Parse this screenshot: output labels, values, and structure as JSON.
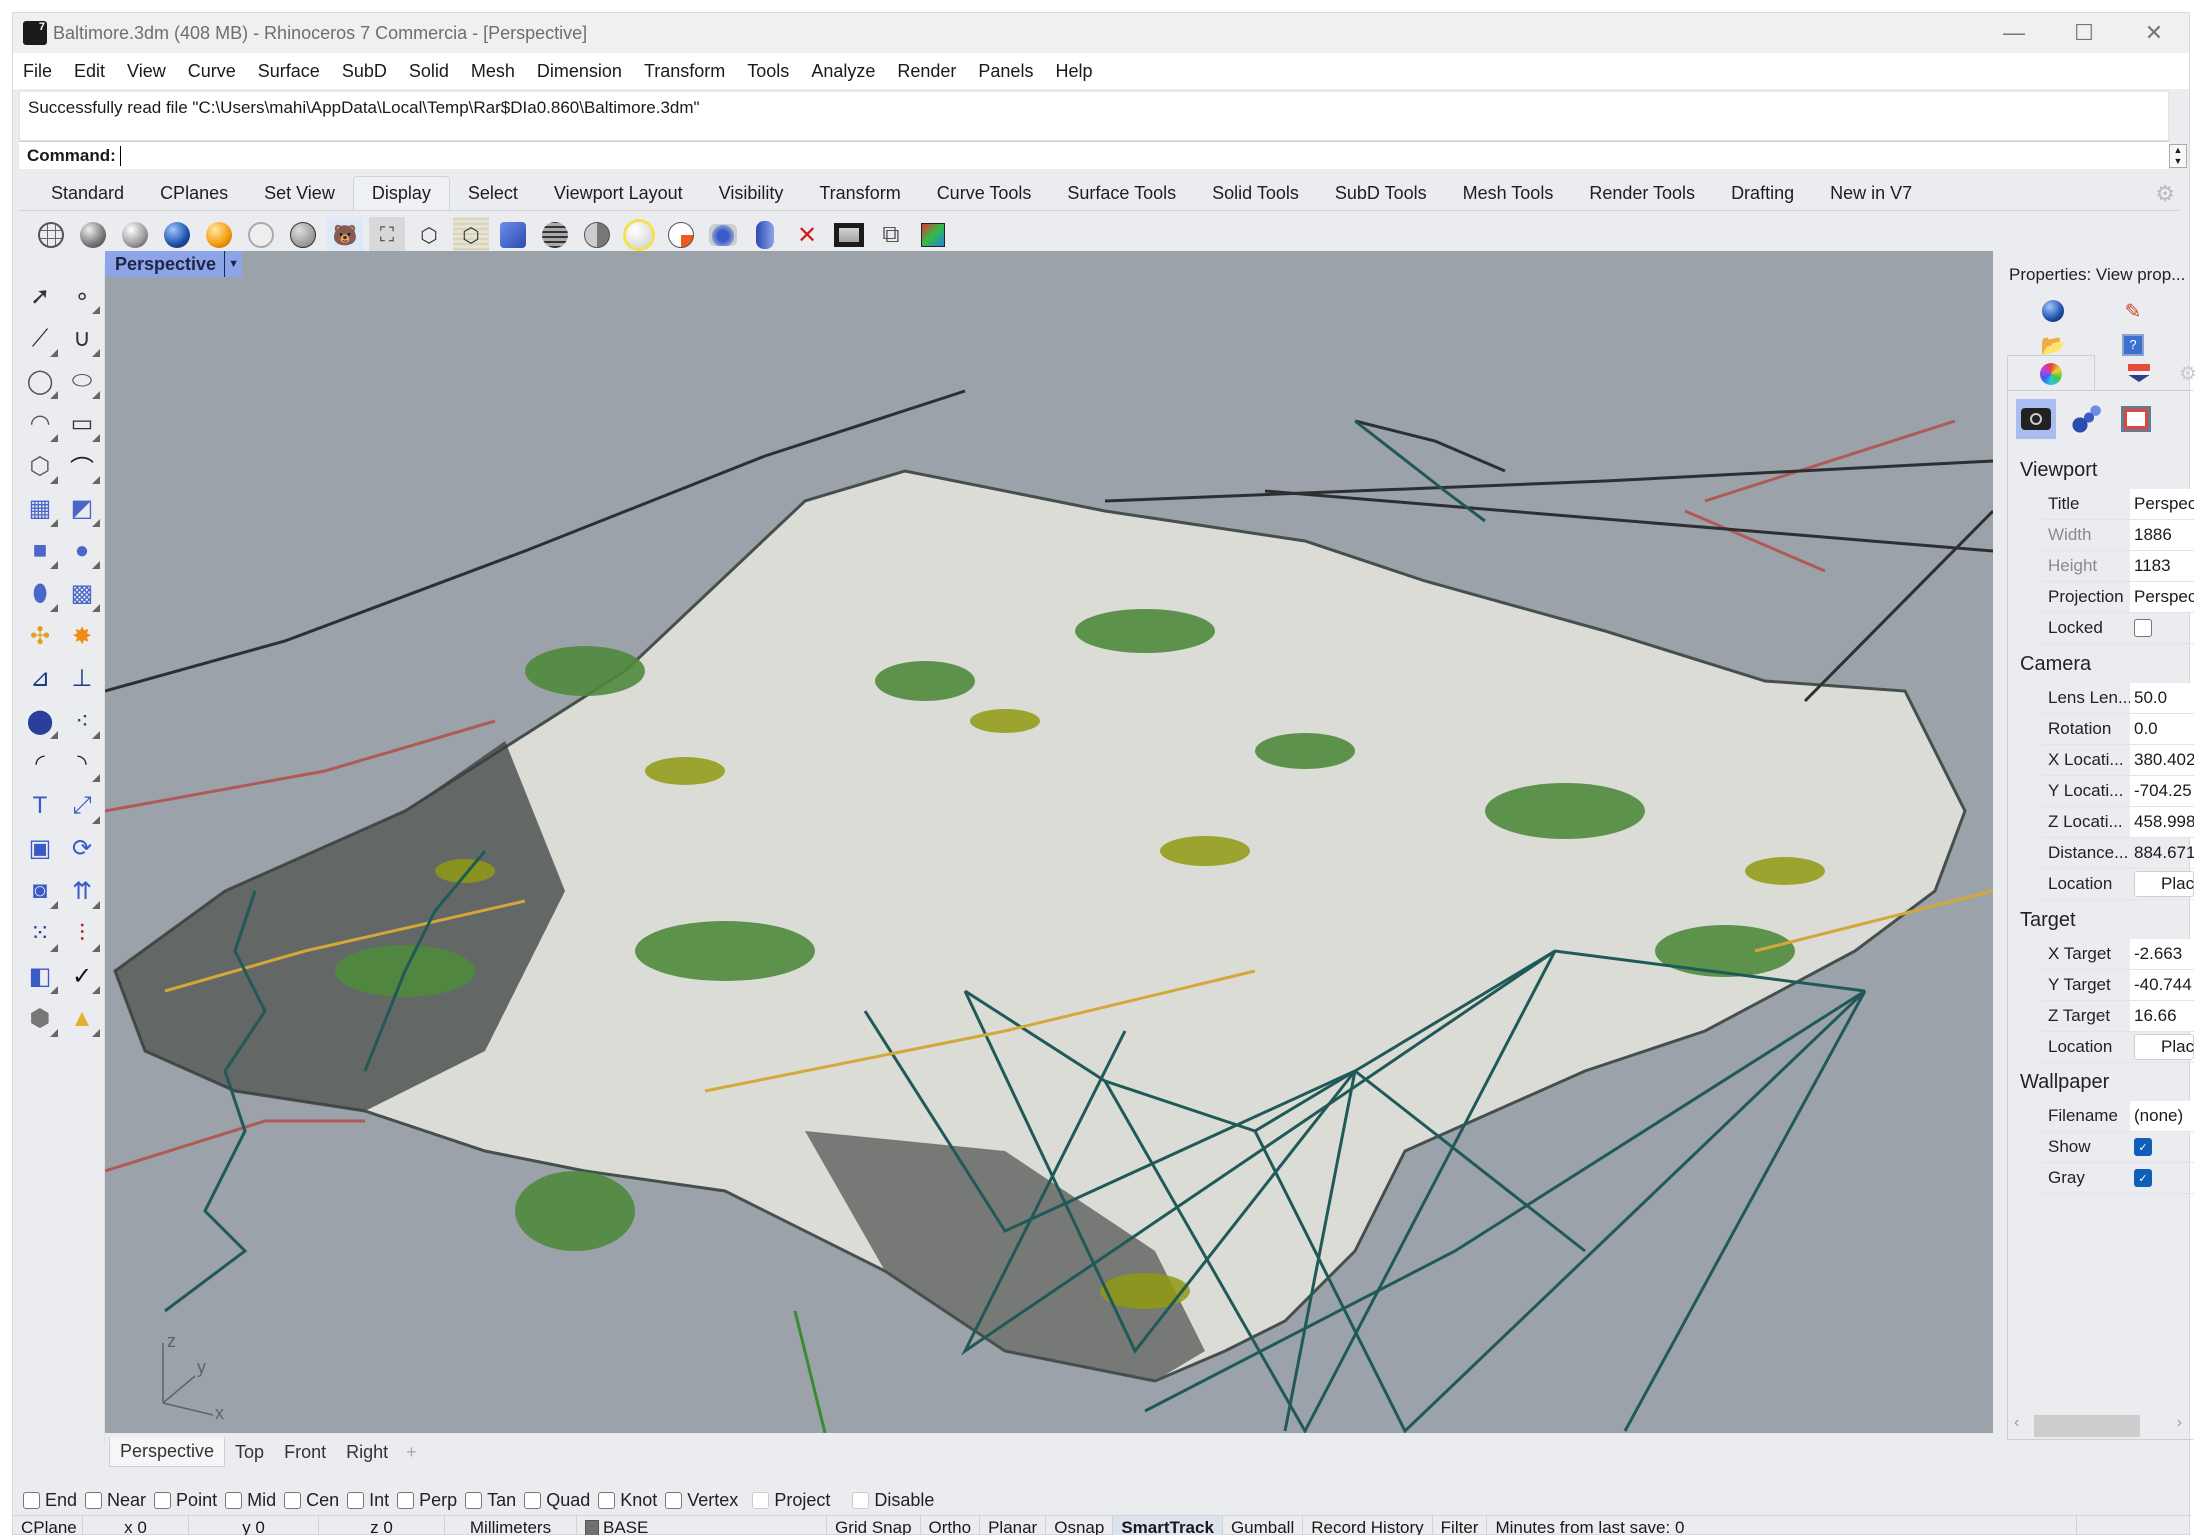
{
  "window": {
    "title": "Baltimore.3dm (408 MB) - Rhinoceros 7 Commercia - [Perspective]",
    "minimize": "—",
    "maximize": "☐",
    "close": "✕"
  },
  "menu": [
    "File",
    "Edit",
    "View",
    "Curve",
    "Surface",
    "SubD",
    "Solid",
    "Mesh",
    "Dimension",
    "Transform",
    "Tools",
    "Analyze",
    "Render",
    "Panels",
    "Help"
  ],
  "command": {
    "history": "Successfully read file \"C:\\Users\\mahi\\AppData\\Local\\Temp\\Rar$DIa0.860\\Baltimore.3dm\"",
    "prompt": "Command:",
    "value": ""
  },
  "toolbar_tabs": {
    "items": [
      "Standard",
      "CPlanes",
      "Set View",
      "Display",
      "Select",
      "Viewport Layout",
      "Visibility",
      "Transform",
      "Curve Tools",
      "Surface Tools",
      "Solid Tools",
      "SubD Tools",
      "Mesh Tools",
      "Render Tools",
      "Drafting",
      "New in V7"
    ],
    "active": "Display"
  },
  "display_icons": [
    "wireframe-icon",
    "shaded-icon",
    "shaded-outline-icon",
    "rendered-icon",
    "rendered-gold-icon",
    "ghosted-icon",
    "xray-icon",
    "arctic-bear-icon",
    "technical-icon",
    "pen-icon",
    "artistic-icon",
    "display-swap-icon",
    "mesh-settings-icon",
    "half-shade-icon",
    "light-icon",
    "cplane-axes-icon",
    "camera-icon",
    "clipping-plane-icon",
    "disable-clipping-icon",
    "monitor-icon",
    "ghost-object-icon",
    "color-object-icon"
  ],
  "left_tools": [
    "select-arrow-icon",
    "point-icon",
    "polyline-icon",
    "curve-icon",
    "circle-icon",
    "ellipse-icon",
    "arc-icon",
    "rectangle-icon",
    "polygon-icon",
    "fillet-curve-icon",
    "surface-corner-icon",
    "extrude-surface-icon",
    "box-icon",
    "sphere-union-icon",
    "cylinder-icon",
    "srf-network-icon",
    "join-icon",
    "explode-icon",
    "trim-icon",
    "split-icon",
    "boolean-union-icon",
    "boolean-split-icon",
    "fillet-icon",
    "offset-icon",
    "text-icon",
    "move-icon",
    "array-icon",
    "rotate-icon",
    "solid-edit-icon",
    "project-icon",
    "grid-array-icon",
    "align-icon",
    "analyze-icon",
    "check-icon",
    "render-primitives-icon",
    "pyramid-icon"
  ],
  "viewport": {
    "name": "Perspective",
    "dropdown": "▼",
    "axes": {
      "x": "x",
      "y": "y",
      "z": "z"
    },
    "colors": {
      "background": "#9ba2aa",
      "urban_fill": "#e9e9e6",
      "road_dark": "#2d2f30",
      "vegetation": "#4e8a3c",
      "vegetation_yellow": "#8f9a12",
      "water_mesh": "#1f5a58",
      "rail_red": "#b05a58",
      "highway": "#d4a73a"
    }
  },
  "viewport_tabs": {
    "items": [
      "Perspective",
      "Top",
      "Front",
      "Right"
    ],
    "active": "Perspective",
    "add": "+"
  },
  "osnaps": [
    {
      "label": "End",
      "checked": false
    },
    {
      "label": "Near",
      "checked": false
    },
    {
      "label": "Point",
      "checked": false
    },
    {
      "label": "Mid",
      "checked": false
    },
    {
      "label": "Cen",
      "checked": false
    },
    {
      "label": "Int",
      "checked": false
    },
    {
      "label": "Perp",
      "checked": false
    },
    {
      "label": "Tan",
      "checked": false
    },
    {
      "label": "Quad",
      "checked": false
    },
    {
      "label": "Knot",
      "checked": false
    },
    {
      "label": "Vertex",
      "checked": false
    },
    {
      "label": "Project",
      "checked": false
    },
    {
      "label": "Disable",
      "checked": false
    }
  ],
  "status": {
    "cplane": "CPlane",
    "x": "x 0",
    "y": "y 0",
    "z": "z 0",
    "units": "Millimeters",
    "layer": "BASE",
    "grid_snap": "Grid Snap",
    "ortho": "Ortho",
    "planar": "Planar",
    "osnap": "Osnap",
    "smarttrack": "SmartTrack",
    "gumball": "Gumball",
    "record_history": "Record History",
    "filter": "Filter",
    "save_info": "Minutes from last save: 0"
  },
  "properties": {
    "title": "Properties: View prop...",
    "sections": {
      "viewport": {
        "heading": "Viewport",
        "rows": [
          {
            "key": "Title",
            "value": "Perspective"
          },
          {
            "key": "Width",
            "value": "1886"
          },
          {
            "key": "Height",
            "value": "1183"
          },
          {
            "key": "Projection",
            "value": "Perspective"
          },
          {
            "key": "Locked",
            "value": false
          }
        ]
      },
      "camera": {
        "heading": "Camera",
        "rows": [
          {
            "key": "Lens Len...",
            "value": "50.0"
          },
          {
            "key": "Rotation",
            "value": "0.0"
          },
          {
            "key": "X Locati...",
            "value": "380.402"
          },
          {
            "key": "Y Locati...",
            "value": "-704.25"
          },
          {
            "key": "Z Locati...",
            "value": "458.998"
          },
          {
            "key": "Distance...",
            "value": "884.671"
          },
          {
            "key": "Location",
            "value": "Place..."
          }
        ]
      },
      "target": {
        "heading": "Target",
        "rows": [
          {
            "key": "X Target",
            "value": "-2.663"
          },
          {
            "key": "Y Target",
            "value": "-40.744"
          },
          {
            "key": "Z Target",
            "value": "16.66"
          },
          {
            "key": "Location",
            "value": "Place..."
          }
        ]
      },
      "wallpaper": {
        "heading": "Wallpaper",
        "rows": [
          {
            "key": "Filename",
            "value": "(none)"
          },
          {
            "key": "Show",
            "value": true
          },
          {
            "key": "Gray",
            "value": true
          }
        ]
      }
    }
  }
}
